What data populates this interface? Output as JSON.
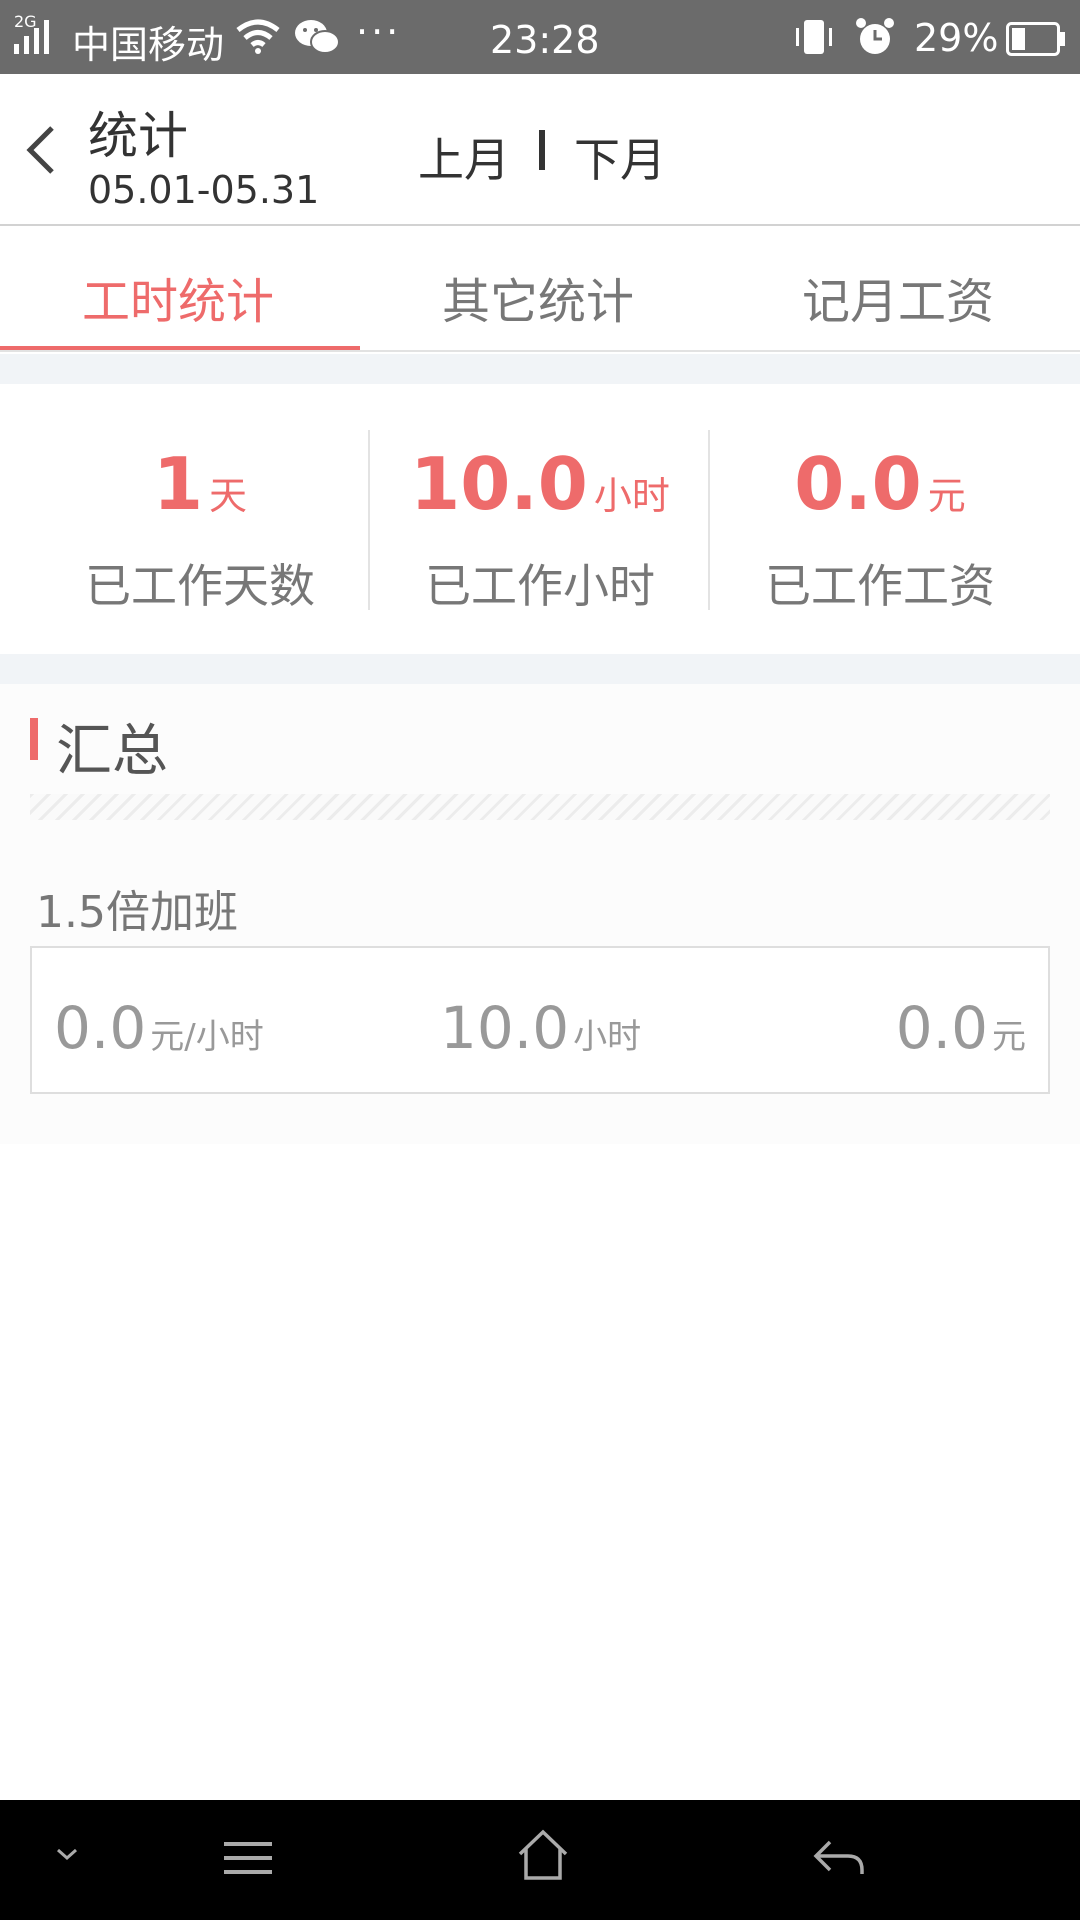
{
  "status_bar": {
    "network": "2G",
    "carrier": "中国移动",
    "more": "···",
    "time": "23:28",
    "battery": "29%",
    "icons": [
      "signal-icon",
      "wifi-icon",
      "wechat-icon",
      "vibrate-icon",
      "alarm-icon",
      "battery-icon"
    ]
  },
  "header": {
    "title": "统计",
    "date_range": "05.01-05.31",
    "prev_month": "上月",
    "next_month": "下月"
  },
  "tabs": [
    {
      "label": "工时统计",
      "active": true
    },
    {
      "label": "其它统计",
      "active": false
    },
    {
      "label": "记月工资",
      "active": false
    }
  ],
  "stats": [
    {
      "value": "1",
      "unit": "天",
      "label": "已工作天数"
    },
    {
      "value": "10.0",
      "unit": "小时",
      "label": "已工作小时"
    },
    {
      "value": "0.0",
      "unit": "元",
      "label": "已工作工资"
    }
  ],
  "summary": {
    "title": "汇总",
    "overtime": {
      "label": "1.5倍加班",
      "rate": "0.0",
      "rate_unit": "元/小时",
      "hours": "10.0",
      "hours_unit": "小时",
      "amount": "0.0",
      "amount_unit": "元"
    }
  },
  "nav_bar": {
    "icons": [
      "chevron-down-icon",
      "menu-icon",
      "home-icon",
      "back-arrow-icon"
    ]
  },
  "colors": {
    "accent": "#ee6b6b",
    "status_bar": "#6b6b6b",
    "page_gap": "#f1f4f7"
  }
}
